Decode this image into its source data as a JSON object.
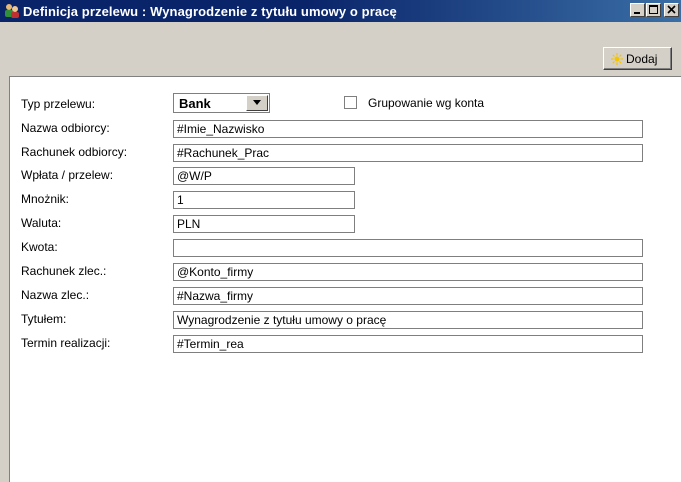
{
  "window": {
    "title": "Definicja przelewu : Wynagrodzenie z tytułu umowy o pracę",
    "icon": "people-icon"
  },
  "toolbar": {
    "add_label": "Dodaj",
    "add_icon": "sun-icon"
  },
  "form": {
    "transfer_type": {
      "label": "Typ przelewu:",
      "value": "Bank",
      "dropdown_icon": "chevron-down-icon"
    },
    "group_by_account": {
      "label": "Grupowanie wg konta",
      "checked": false
    },
    "fields": [
      {
        "label": "Nazwa odbiorcy:",
        "value": "#Imie_Nazwisko"
      },
      {
        "label": "Rachunek odbiorcy:",
        "value": "#Rachunek_Prac"
      },
      {
        "label": "Wpłata / przelew:",
        "value": "@W/P"
      },
      {
        "label": "Mnożnik:",
        "value": "1"
      },
      {
        "label": "Waluta:",
        "value": "PLN"
      },
      {
        "label": "Kwota:",
        "value": ""
      },
      {
        "label": "Rachunek zlec.:",
        "value": "@Konto_firmy"
      },
      {
        "label": "Nazwa zlec.:",
        "value": "#Nazwa_firmy"
      },
      {
        "label": "Tytułem:",
        "value": "Wynagrodzenie z tytułu umowy o pracę"
      },
      {
        "label": "Termin realizacji:",
        "value": "#Termin_rea"
      }
    ]
  },
  "colors": {
    "title_bar": "#0a246a",
    "face": "#d4d0c8",
    "panel": "#ffffff"
  }
}
